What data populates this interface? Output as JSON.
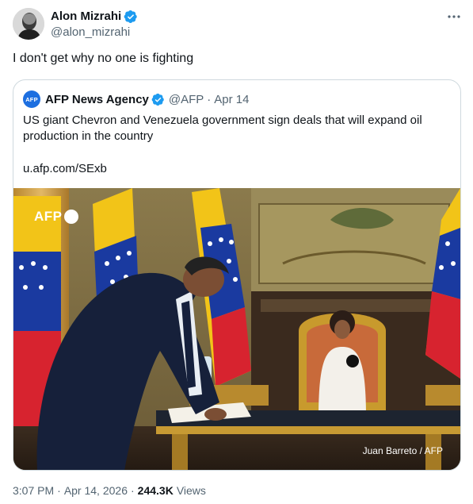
{
  "tweet": {
    "author": {
      "display_name": "Alon Mizrahi",
      "handle": "@alon_mizrahi",
      "verified": true
    },
    "text": "I don't get why no one is fighting",
    "timestamp": {
      "time": "3:07 PM",
      "date": "Apr 14, 2026"
    },
    "views": {
      "count": "244.3K",
      "label": "Views"
    },
    "separator": "·"
  },
  "quote": {
    "avatar_text": "AFP",
    "author_name": "AFP News Agency",
    "handle": "@AFP",
    "date": "Apr 14",
    "text": "US giant Chevron and Venezuela government sign deals that will expand oil production in the country",
    "link": "u.afp.com/SExb",
    "photo": {
      "watermark": "AFP",
      "credit": "Juan Barreto / AFP"
    }
  },
  "icons": {
    "verified": "verified-badge-icon",
    "more": "more-options-icon"
  },
  "colors": {
    "verified_blue": "#1d9bf0",
    "text": "#0f1419",
    "secondary": "#536471",
    "border": "#cfd9de"
  }
}
